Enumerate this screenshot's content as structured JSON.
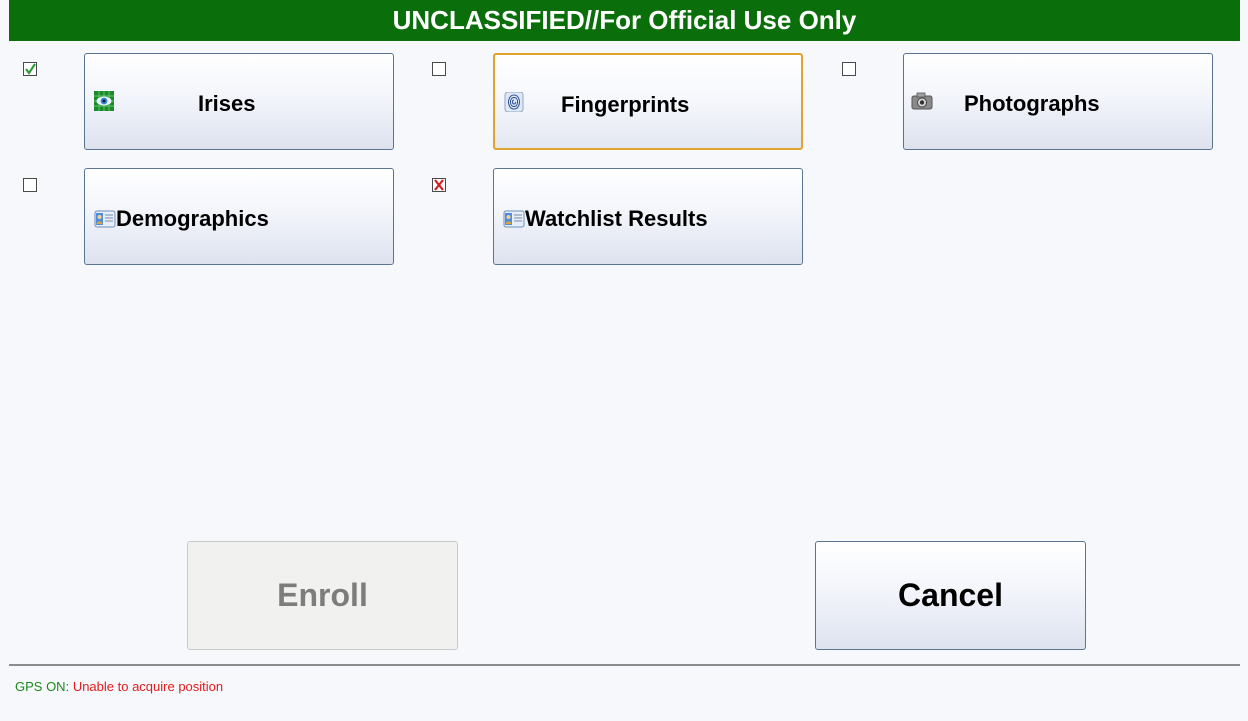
{
  "banner": {
    "text": "UNCLASSIFIED//For Official Use Only",
    "bg_color": "#0a6e0a"
  },
  "modalities": [
    {
      "label": "Irises",
      "icon": "iris-scan-icon",
      "checkbox": "checked"
    },
    {
      "label": "Fingerprints",
      "icon": "fingerprint-icon",
      "checkbox": "unchecked",
      "focused": true
    },
    {
      "label": "Photographs",
      "icon": "camera-icon",
      "checkbox": "unchecked"
    },
    {
      "label": "Demographics",
      "icon": "id-card-icon",
      "checkbox": "unchecked"
    },
    {
      "label": "Watchlist Results",
      "icon": "id-card-icon",
      "checkbox": "failed"
    }
  ],
  "actions": {
    "enroll_label": "Enroll",
    "enroll_enabled": false,
    "cancel_label": "Cancel"
  },
  "status": {
    "gps_label": "GPS ON:",
    "gps_message": "Unable to acquire position",
    "gps_color": "#1b8a1b",
    "message_color": "#e21b1b"
  }
}
